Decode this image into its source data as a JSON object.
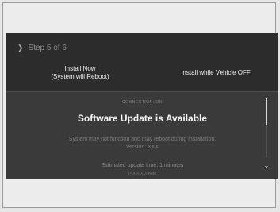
{
  "header": {
    "step_text": "Step 5 of 6"
  },
  "options": {
    "install_now_line1": "Install Now",
    "install_now_line2": "(System will Reboot)",
    "install_off": "Install while Vehicle OFF"
  },
  "notice": {
    "connection": "CONNECTION: ON",
    "title": "Software Update is Available",
    "message_line1": "System may not function and may reboot during installation.",
    "message_line2": "Version: XXX",
    "estimated_time": "Estimated update time: 1 minutes",
    "extra": "P-X-X-X-X   Auto"
  },
  "icons": {
    "step_arrow": "chevron-right-icon",
    "scroll_down": "chevron-down-icon"
  },
  "colors": {
    "screen_background": "#2c2c2c",
    "panel_background": "#3a3a3a",
    "text_primary": "#f2f2f2",
    "text_muted": "#8a8a8a"
  }
}
